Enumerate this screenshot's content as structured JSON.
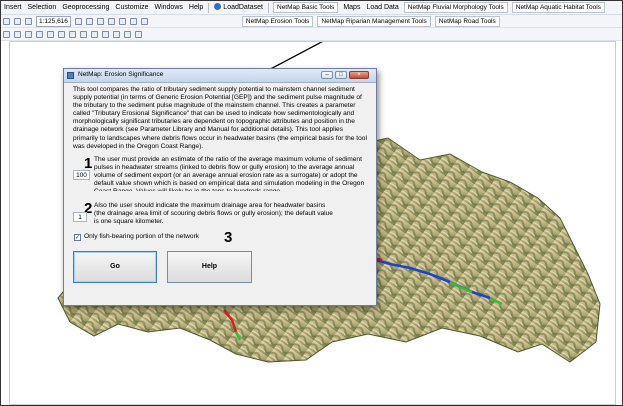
{
  "menubar": {
    "items": [
      "Insert",
      "Selection",
      "Geoprocessing",
      "Customize",
      "Windows",
      "Help"
    ],
    "load_dataset": "LoadDataset",
    "basic_tools": "NetMap Basic Tools",
    "maps": "Maps",
    "load_data": "Load Data",
    "fluvial_tools": "NetMap Fluvial Morphology Tools",
    "aquatic_tools": "NetMap Aquatic Habitat Tools"
  },
  "toolbar": {
    "scale": "1:125,616",
    "erosion_tools": "NetMap Erosion Tools",
    "riparian_tools": "NetMap Riparian Management Tools",
    "road_tools": "NetMap Road Tools"
  },
  "dialog": {
    "title": "NetMap: Erosion Significance",
    "description": "This tool compares the ratio of tributary sediment supply potential to mainstem channel sediment supply potential (in terms of Generic Erosion Potential [GEP]) and the sediment pulse magnitude of the tributary to the sediment pulse magnitude of the mainstem channel. This creates a parameter called \"Tributary Erosional Significance\" that can be used to indicate how sedimentologically and morphologically significant tributaries are dependent on topographic attributes and position in the drainage network (see Parameter Library and Manual for additional details). This tool applies primarily to landscapes where debris flows occur in headwater basins (the empirical basis for the tool was developed in the Oregon Coast Range).",
    "step1_marker": "1",
    "step1_value": "100",
    "step1_text": "The user must provide an estimate of the ratio of the average maximum volume of sediment pulses in headwater streams (linked to debris flow or gully erosion) to the average annual volume of sediment export (or an average annual erosion rate as a surrogate) or adopt the default value shown which is based on empirical data and simulation modeling in the Oregon Coast Range. Values will likely be in the tens to hundreds range.",
    "step2_marker": "2",
    "step2_value": "1",
    "step2_text": "Also the user should indicate the maximum drainage area for headwater basins (the drainage area limit of scouring debris flows or gully erosion); the default value is one square kilometer.",
    "step3_marker": "3",
    "checkbox_label": "Only fish-bearing portion of the network",
    "checkbox_checked": true,
    "checkmark": "✓",
    "go_label": "Go",
    "help_label": "Help"
  },
  "colors": {
    "terrain_dark": "#5a6a3a",
    "terrain_light": "#f1e6c2",
    "stream_blue": "#1f3fd8",
    "stream_green": "#3ab83a",
    "stream_red": "#d81f1f"
  }
}
